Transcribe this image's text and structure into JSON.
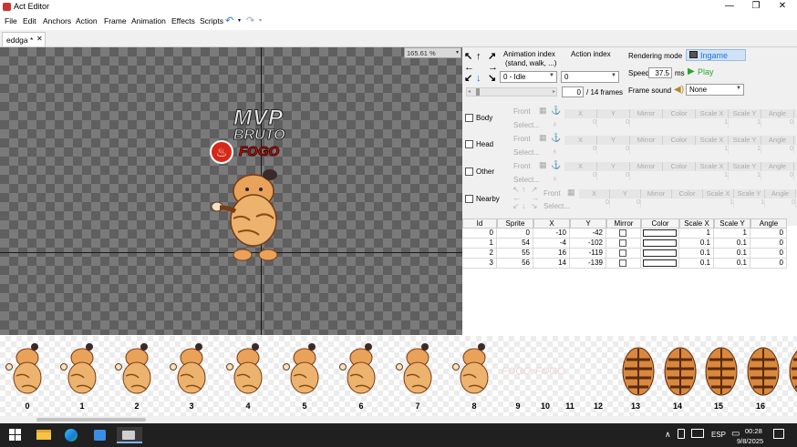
{
  "window": {
    "title": "Act Editor"
  },
  "menu": [
    "File",
    "Edit",
    "Anchors",
    "Action",
    "Frame",
    "Animation",
    "Effects",
    "Scripts"
  ],
  "tab": {
    "label": "eddga *"
  },
  "canvas": {
    "zoom": "165.61 %"
  },
  "controls": {
    "animation_index_label": "Animation index",
    "animation_index_sub": "(stand, walk, ...)",
    "animation_index_value": "0 - Idle",
    "action_index_label": "Action index",
    "action_index_value": "0",
    "rendering_mode_label": "Rendering mode",
    "rendering_mode_value": "Ingame",
    "speed_label": "Speed",
    "speed_value": "37.5",
    "speed_unit": "ms",
    "play_label": "Play",
    "frame_value": "0",
    "frame_total": "/ 14 frames",
    "frame_sound_label": "Frame sound",
    "frame_sound_value": "None"
  },
  "anchor_panel": {
    "rows": [
      {
        "label": "Body",
        "front": "Front",
        "select": "Select..."
      },
      {
        "label": "Head",
        "front": "Front",
        "select": "Select..."
      },
      {
        "label": "Other",
        "front": "Front",
        "select": "Select..."
      },
      {
        "label": "Nearby",
        "front": "Front",
        "select": "Select..."
      }
    ],
    "columns": [
      "X",
      "Y",
      "Mirror",
      "Color",
      "Scale X",
      "Scale Y",
      "Angle"
    ],
    "values": [
      "0",
      "0",
      "",
      "",
      "1",
      "1",
      "0"
    ]
  },
  "layers_table": {
    "columns": [
      "Id",
      "Sprite",
      "X",
      "Y",
      "Mirror",
      "Color",
      "Scale X",
      "Scale Y",
      "Angle"
    ],
    "rows": [
      [
        "0",
        "0",
        "-10",
        "-42",
        "",
        "",
        "1",
        "1",
        "0"
      ],
      [
        "1",
        "54",
        "-4",
        "-102",
        "",
        "",
        "0.1",
        "0.1",
        "0"
      ],
      [
        "2",
        "55",
        "16",
        "-119",
        "",
        "",
        "0.1",
        "0.1",
        "0"
      ],
      [
        "3",
        "56",
        "14",
        "-139",
        "",
        "",
        "0.1",
        "0.1",
        "0"
      ]
    ]
  },
  "overlay_text": {
    "line1": "MVP",
    "line2": "BRUTO",
    "line3": "FOGO"
  },
  "sprite_strip": {
    "labels": [
      "0",
      "1",
      "2",
      "3",
      "4",
      "5",
      "6",
      "7",
      "8",
      "9",
      "10",
      "11",
      "12",
      "13",
      "14",
      "15",
      "16"
    ]
  },
  "taskbar": {
    "language": "ESP",
    "time": "00:28",
    "date": "9/8/2025"
  },
  "colors": {
    "accent": "#1e72d8",
    "play": "#2aa52a",
    "taskbar": "#202020"
  }
}
